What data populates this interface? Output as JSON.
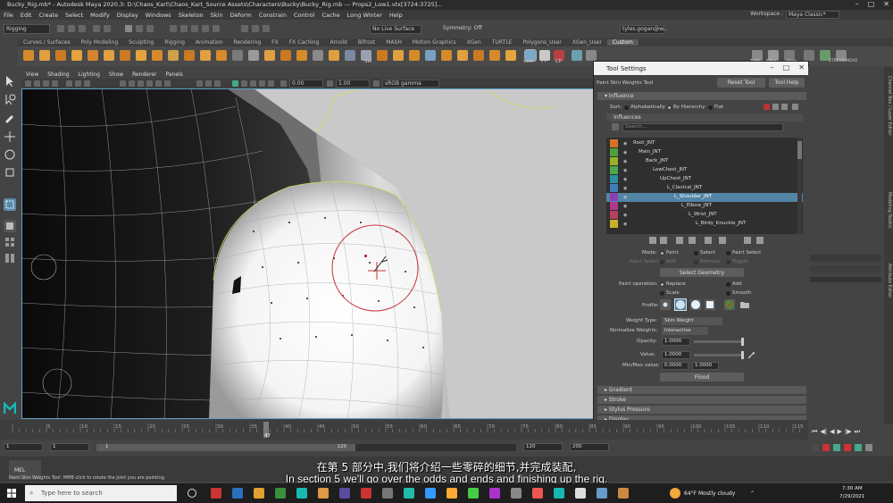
{
  "window": {
    "title": "Bucky_Rig.mb* - Autodesk Maya 2020.3: D:\\Chaos_Kart\\Chaos_Kart_Source Assets\\Characters\\Bucky\\Bucky_Rig.mb  ---  Props2_Low1.vtx[3724:3725]..."
  },
  "menubar": {
    "items": [
      "File",
      "Edit",
      "Create",
      "Select",
      "Modify",
      "Display",
      "Windows",
      "Skeleton",
      "Skin",
      "Deform",
      "Constrain",
      "Control",
      "Cache",
      "Long Winter",
      "Help"
    ]
  },
  "workspace": {
    "label": "Workspace :",
    "value": "Maya Classic*"
  },
  "statusline": {
    "mode": "Rigging",
    "surface_field": "No Live Surface",
    "symmetry": "Symmetry: Off",
    "user": "tyles.gogan@w..."
  },
  "shelf": {
    "tabs": [
      "Curves / Surfaces",
      "Poly Modeling",
      "Sculpting",
      "Rigging",
      "Animation",
      "Rendering",
      "FX",
      "FX Caching",
      "Arnold",
      "Bifrost",
      "MASH",
      "Motion Graphics",
      "XGen",
      "TURTLE",
      "Polygons_User",
      "XGen_User",
      "Custom"
    ],
    "active_tab": "Custom",
    "icon_labels": [
      "Sel",
      "vert",
      "FT",
      "CP",
      "TMS",
      "Mirr",
      "Seg",
      "STRCVIRMOVE"
    ]
  },
  "viewport": {
    "menus": [
      "View",
      "Shading",
      "Lighting",
      "Show",
      "Renderer",
      "Panels"
    ],
    "exposure": "0.00",
    "gamma": "1.00",
    "color_space": "sRGB gamma"
  },
  "tool_settings": {
    "window_title": "Tool Settings",
    "tool_name": "Paint Skin Weights Tool",
    "reset_button": "Reset Tool",
    "help_button": "Tool Help",
    "influence_section": "Influence",
    "sort_label": "Sort:",
    "sort_options": [
      "Alphabetically",
      "By Hierarchy",
      "Flat"
    ],
    "sort_selected": "By Hierarchy",
    "influences_label": "Influences",
    "search_placeholder": "Search...",
    "joints": [
      {
        "name": "Root_JNT",
        "color": "#d8702a"
      },
      {
        "name": "Main_JNT",
        "color": "#4ea03a"
      },
      {
        "name": "Back_JNT",
        "color": "#9ab02c"
      },
      {
        "name": "LowChest_JNT",
        "color": "#49a84a"
      },
      {
        "name": "UpChest_JNT",
        "color": "#2c8fa0"
      },
      {
        "name": "L_Clavical_JNT",
        "color": "#3e7fb8"
      },
      {
        "name": "L_Shoulder_JNT",
        "color": "#8b3fb0"
      },
      {
        "name": "L_Elbow_JNT",
        "color": "#b03a8c"
      },
      {
        "name": "L_Wrist_JNT",
        "color": "#b54060"
      },
      {
        "name": "L_Birdy_Knuckle_JNT",
        "color": "#c9b22a"
      }
    ],
    "selected_joint": "L_Shoulder_JNT",
    "mode_label": "Mode:",
    "mode_options": [
      "Paint",
      "Select",
      "Paint Select"
    ],
    "mode_selected": "Paint",
    "paint_select_label": "Paint Select:",
    "paint_select_options": [
      "Add",
      "Remove",
      "Toggle"
    ],
    "select_geometry_button": "Select Geometry",
    "paint_operation_label": "Paint operation:",
    "paint_operations": [
      "Replace",
      "Add",
      "Scale",
      "Smooth"
    ],
    "paint_operation_selected": "Replace",
    "profile_label": "Profile:",
    "weight_type_label": "Weight Type:",
    "weight_type_value": "Skin Weight",
    "normalize_label": "Normalize Weights:",
    "normalize_value": "Interactive",
    "opacity_label": "Opacity:",
    "opacity_value": "1.0000",
    "value_label": "Value:",
    "value_value": "1.0000",
    "minmax_label": "Min/Max value:",
    "min_value": "0.0000",
    "max_value": "1.0000",
    "flood_button": "Flood",
    "collapsed_sections": [
      "Gradient",
      "Stroke",
      "Stylus Pressure",
      "Display"
    ]
  },
  "right_strip": [
    "Channel Box / Layer Editor",
    "Modeling Toolkit",
    "Attribute Editor"
  ],
  "timeslider": {
    "ticks": [
      "5",
      "10",
      "15",
      "20",
      "25",
      "30",
      "35",
      "40",
      "45",
      "50",
      "55",
      "60",
      "65",
      "70",
      "75",
      "80",
      "85",
      "90",
      "95",
      "100",
      "105",
      "110",
      "115"
    ],
    "current_frame": "47"
  },
  "rangeslider": {
    "start": "1",
    "start_inner": "1",
    "handle_start": "1",
    "handle_end": "120",
    "end_inner": "120",
    "end": "200"
  },
  "cmdline": {
    "lang": "MEL",
    "help_text": "Paint Skin Weights Tool: MMB click to rotate the joint you are painting."
  },
  "subtitles": {
    "chinese": "在第 5 部分中,我们将介绍一些零碎的细节,并完成装配,",
    "english": "In section 5 we'll go over the odds and ends and finishing up the rig."
  },
  "taskbar": {
    "search_placeholder": "Type here to search",
    "weather": "64°F  Mostly cloudy",
    "time": "7:30 AM",
    "date": "7/29/2021"
  },
  "colors": {
    "accent_selected": "#5285a6",
    "brush_ring": "#c8323c"
  }
}
